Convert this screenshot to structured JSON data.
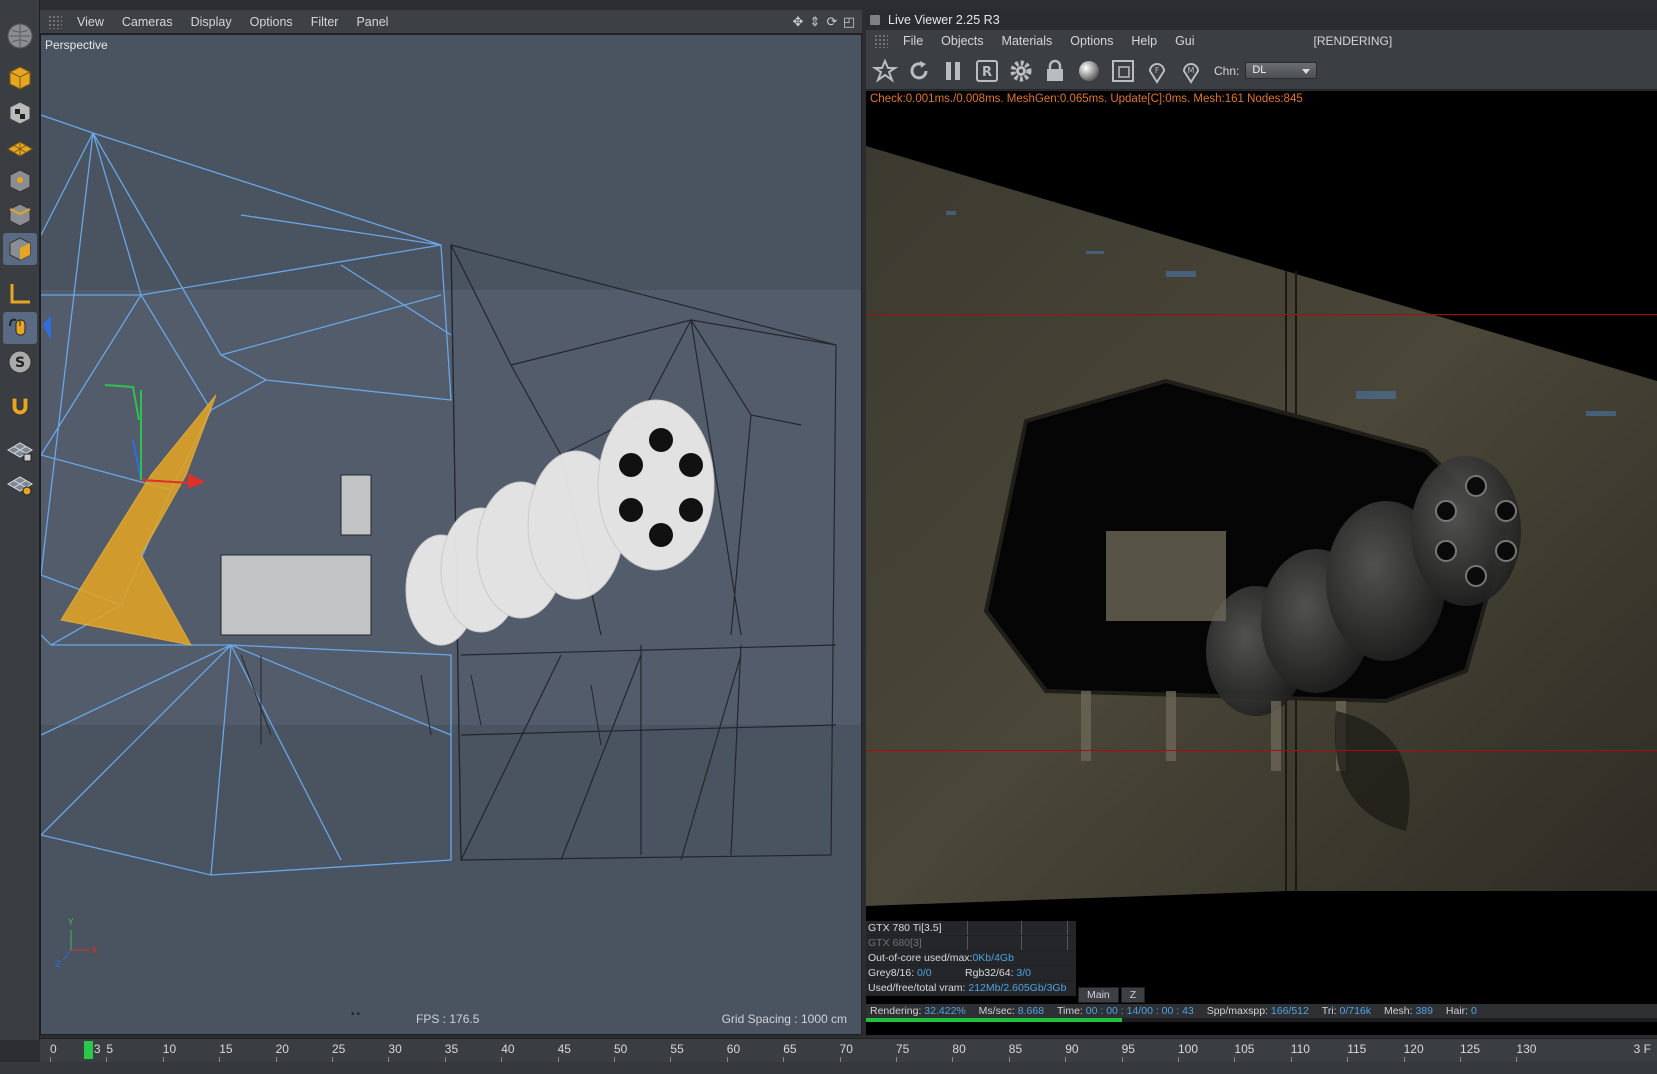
{
  "viewport": {
    "menu": [
      "View",
      "Cameras",
      "Display",
      "Options",
      "Filter",
      "Panel"
    ],
    "label": "Perspective",
    "fps": "FPS : 176.5",
    "grid_spacing": "Grid Spacing : 1000 cm"
  },
  "tools": [
    "model-icon",
    "texture-icon",
    "workplane-icon",
    "point-icon",
    "edge-icon",
    "polygon-icon",
    "axis-icon",
    "tweak-icon",
    "snap-icon",
    "magnet-icon",
    "lock-grid-icon",
    "grid-icon"
  ],
  "live_viewer": {
    "title": "Live Viewer 2.25 R3",
    "menu": [
      "File",
      "Objects",
      "Materials",
      "Options",
      "Help",
      "Gui"
    ],
    "status_tag": "[RENDERING]",
    "channel_label": "Chn:",
    "channel_value": "DL",
    "stats": "Check:0.001ms./0.008ms. MeshGen:0.065ms. Update[C]:0ms. Mesh:161 Nodes:845",
    "gpu": {
      "primary": "GTX 780 Ti[3.5]",
      "secondary": "GTX 680[3]",
      "out_of_core_label": "Out-of-core used/max:",
      "out_of_core_value": "0Kb/4Gb",
      "grey_label": "Grey8/16:",
      "grey_value": "0/0",
      "rgb_label": "Rgb32/64:",
      "rgb_value": "3/0",
      "vram_label": "Used/free/total vram:",
      "vram_value": "212Mb/2.605Gb/3Gb"
    },
    "tabs": [
      "Main",
      "Z"
    ],
    "footer": {
      "rendering_label": "Rendering:",
      "rendering_value": "32.422%",
      "ms_label": "Ms/sec:",
      "ms_value": "8.668",
      "time_label": "Time:",
      "time_value": "00 : 00 : 14/00 : 00 : 43",
      "spp_label": "Spp/maxspp:",
      "spp_value": "166/512",
      "tri_label": "Tri:",
      "tri_value": "0/716k",
      "mesh_label": "Mesh:",
      "mesh_value": "389",
      "hair_label": "Hair:",
      "hair_value": "0"
    },
    "progress": 0.32422
  },
  "timeline": {
    "ticks": [
      "0",
      "5",
      "10",
      "15",
      "20",
      "25",
      "30",
      "35",
      "40",
      "45",
      "50",
      "55",
      "60",
      "65",
      "70",
      "75",
      "80",
      "85",
      "90",
      "95",
      "100",
      "105",
      "110",
      "115",
      "120",
      "125",
      "130"
    ],
    "current_frame": "3",
    "readout": "3 F"
  },
  "colors": {
    "wire_blue": "#6aa6e6",
    "selection_orange": "#e6a523",
    "progress_green": "#20c13c",
    "stats_orange": "#e0762a"
  }
}
